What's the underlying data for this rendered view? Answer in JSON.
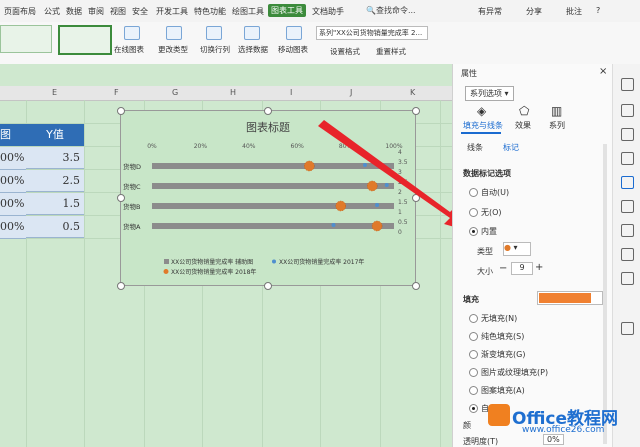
{
  "menu": {
    "items": [
      "页面布局",
      "公式",
      "数据",
      "审阅",
      "视图",
      "安全",
      "开发工具",
      "特色功能",
      "绘图工具",
      "图表工具",
      "文档助手"
    ],
    "active": "图表工具",
    "search": "查找命令...",
    "right": [
      "有异常",
      "分享",
      "批注",
      "?"
    ]
  },
  "ribbon": {
    "buttons": [
      "在线图表",
      "更改类型",
      "切换行列",
      "选择数据",
      "移动图表",
      "设置格式",
      "重置样式"
    ],
    "series_select": "系列\"XX公司货物销量完成率 2..."
  },
  "sheet": {
    "columns": [
      "E",
      "F",
      "G",
      "H",
      "I",
      "J",
      "K"
    ],
    "header_partial": "图",
    "y_header": "Y值",
    "rows": [
      {
        "pct": "00%",
        "y": "3.5"
      },
      {
        "pct": "00%",
        "y": "2.5"
      },
      {
        "pct": "00%",
        "y": "1.5"
      },
      {
        "pct": "00%",
        "y": "0.5"
      }
    ]
  },
  "chart_data": {
    "type": "bar",
    "title": "图表标题",
    "categories": [
      "货物D",
      "货物C",
      "货物B",
      "货物A"
    ],
    "x_ticks": [
      "0%",
      "20%",
      "40%",
      "60%",
      "80%",
      "100%"
    ],
    "y2_ticks": [
      "4",
      "3.5",
      "3",
      "2.5",
      "2",
      "1.5",
      "1",
      "0.5",
      "0"
    ],
    "series": [
      {
        "name": "XX公司货物销量完成率 辅助图",
        "values": [
          1,
          1,
          1,
          1
        ],
        "color": "#8c8c8c"
      },
      {
        "name": "XX公司货物销量完成率 2017年",
        "values": [
          0.88,
          0.97,
          0.93,
          0.75
        ],
        "color": "#4f8fce"
      },
      {
        "name": "XX公司货物销量完成率 2018年",
        "values": [
          0.65,
          0.91,
          0.78,
          0.93
        ],
        "color": "#e07a2a"
      }
    ],
    "legend": "bottom"
  },
  "panel": {
    "title": "属性",
    "series_options": "系列选项",
    "tabs": [
      "填充与线条",
      "效果",
      "系列"
    ],
    "subtabs": [
      "线条",
      "标记"
    ],
    "section_label_options": "数据标记选项",
    "label_options": [
      "自动(U)",
      "无(O)",
      "内置"
    ],
    "type_label": "类型",
    "size_label": "大小",
    "size_value": "9",
    "fill_section": "填充",
    "fill_color": "#f08030",
    "fill_options": [
      "无填充(N)",
      "纯色填充(S)",
      "渐变填充(G)",
      "图片或纹理填充(P)",
      "图案填充(A)",
      "自动(U)"
    ],
    "color_label": "颜",
    "transparency_label": "透明度(T)",
    "transparency_value": "0%"
  },
  "watermark": {
    "title": "Office教程网",
    "url": "www.office26.com"
  }
}
